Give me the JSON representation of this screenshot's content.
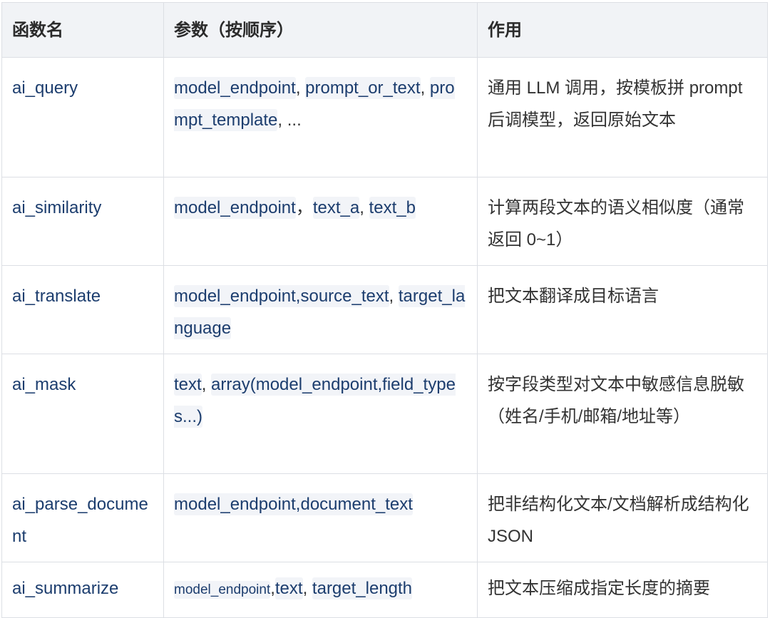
{
  "header": {
    "col1": "函数名",
    "col2": "参数（按顺序）",
    "col3": "作用"
  },
  "rows": [
    {
      "name": "ai_query",
      "params": [
        {
          "t": "code",
          "v": "model_endpoint"
        },
        {
          "t": "sep",
          "v": ", "
        },
        {
          "t": "code",
          "v": "prompt_or_text"
        },
        {
          "t": "sep",
          "v": ", "
        },
        {
          "t": "code",
          "v": "prompt_template"
        },
        {
          "t": "sep",
          "v": ", ..."
        }
      ],
      "desc": "通用 LLM 调用，按模板拼 prompt 后调模型，返回原始文本"
    },
    {
      "name": "ai_similarity",
      "params": [
        {
          "t": "code",
          "v": "model_endpoint"
        },
        {
          "t": "sep",
          "v": "，"
        },
        {
          "t": "code",
          "v": "text_a"
        },
        {
          "t": "sep",
          "v": ", "
        },
        {
          "t": "code",
          "v": "text_b"
        }
      ],
      "desc": "计算两段文本的语义相似度（通常返回 0~1）"
    },
    {
      "name": "ai_translate",
      "params": [
        {
          "t": "code",
          "v": "model_endpoint,source_text"
        },
        {
          "t": "sep",
          "v": ", "
        },
        {
          "t": "code",
          "v": "target_language"
        }
      ],
      "desc": "把文本翻译成目标语言"
    },
    {
      "name": "ai_mask",
      "params": [
        {
          "t": "code",
          "v": "text"
        },
        {
          "t": "sep",
          "v": ", "
        },
        {
          "t": "code",
          "v": "array(model_endpoint,field_types...)"
        }
      ],
      "desc": "按字段类型对文本中敏感信息脱敏（姓名/手机/邮箱/地址等）"
    },
    {
      "name": "ai_parse_document",
      "params": [
        {
          "t": "code",
          "v": "model_endpoint,document_text"
        }
      ],
      "desc": "把非结构化文本/文档解析成结构化 JSON"
    },
    {
      "name": "ai_summarize",
      "params": [
        {
          "t": "code-small",
          "v": "model_endpoint"
        },
        {
          "t": "sep",
          "v": ","
        },
        {
          "t": "code",
          "v": "text"
        },
        {
          "t": "sep",
          "v": ", "
        },
        {
          "t": "code",
          "v": "target_length"
        }
      ],
      "desc": "把文本压缩成指定长度的摘要"
    }
  ]
}
